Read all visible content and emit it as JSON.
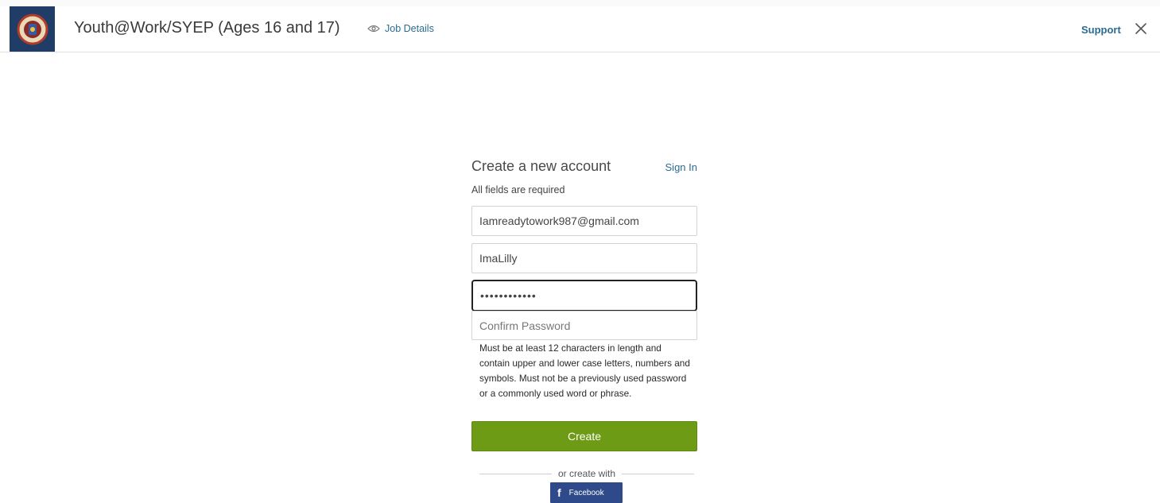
{
  "header": {
    "title": "Youth@Work/SYEP (Ages 16 and 17)",
    "job_details_label": "Job Details",
    "support_label": "Support",
    "logo_icon": "city-seal-icon",
    "eye_icon": "eye-icon",
    "close_icon": "close-icon"
  },
  "form": {
    "title": "Create a new account",
    "signin_label": "Sign In",
    "required_note": "All fields are required",
    "email_value": "Iamreadytowork987@gmail.com",
    "username_value": "ImaLilly",
    "password_value": "••••••••••••",
    "confirm_placeholder": "Confirm Password",
    "password_help": "Must be at least 12 characters in length and contain upper and lower case letters, numbers and symbols. Must not be a previously used password or a commonly used word or phrase.",
    "create_label": "Create",
    "or_text": "or create with",
    "facebook_label": "Facebook",
    "facebook_icon": "facebook-icon"
  },
  "colors": {
    "brand_blue": "#1f3d66",
    "link_blue": "#2b6b91",
    "create_green": "#6e9b16",
    "facebook_blue": "#2e4a8a"
  }
}
